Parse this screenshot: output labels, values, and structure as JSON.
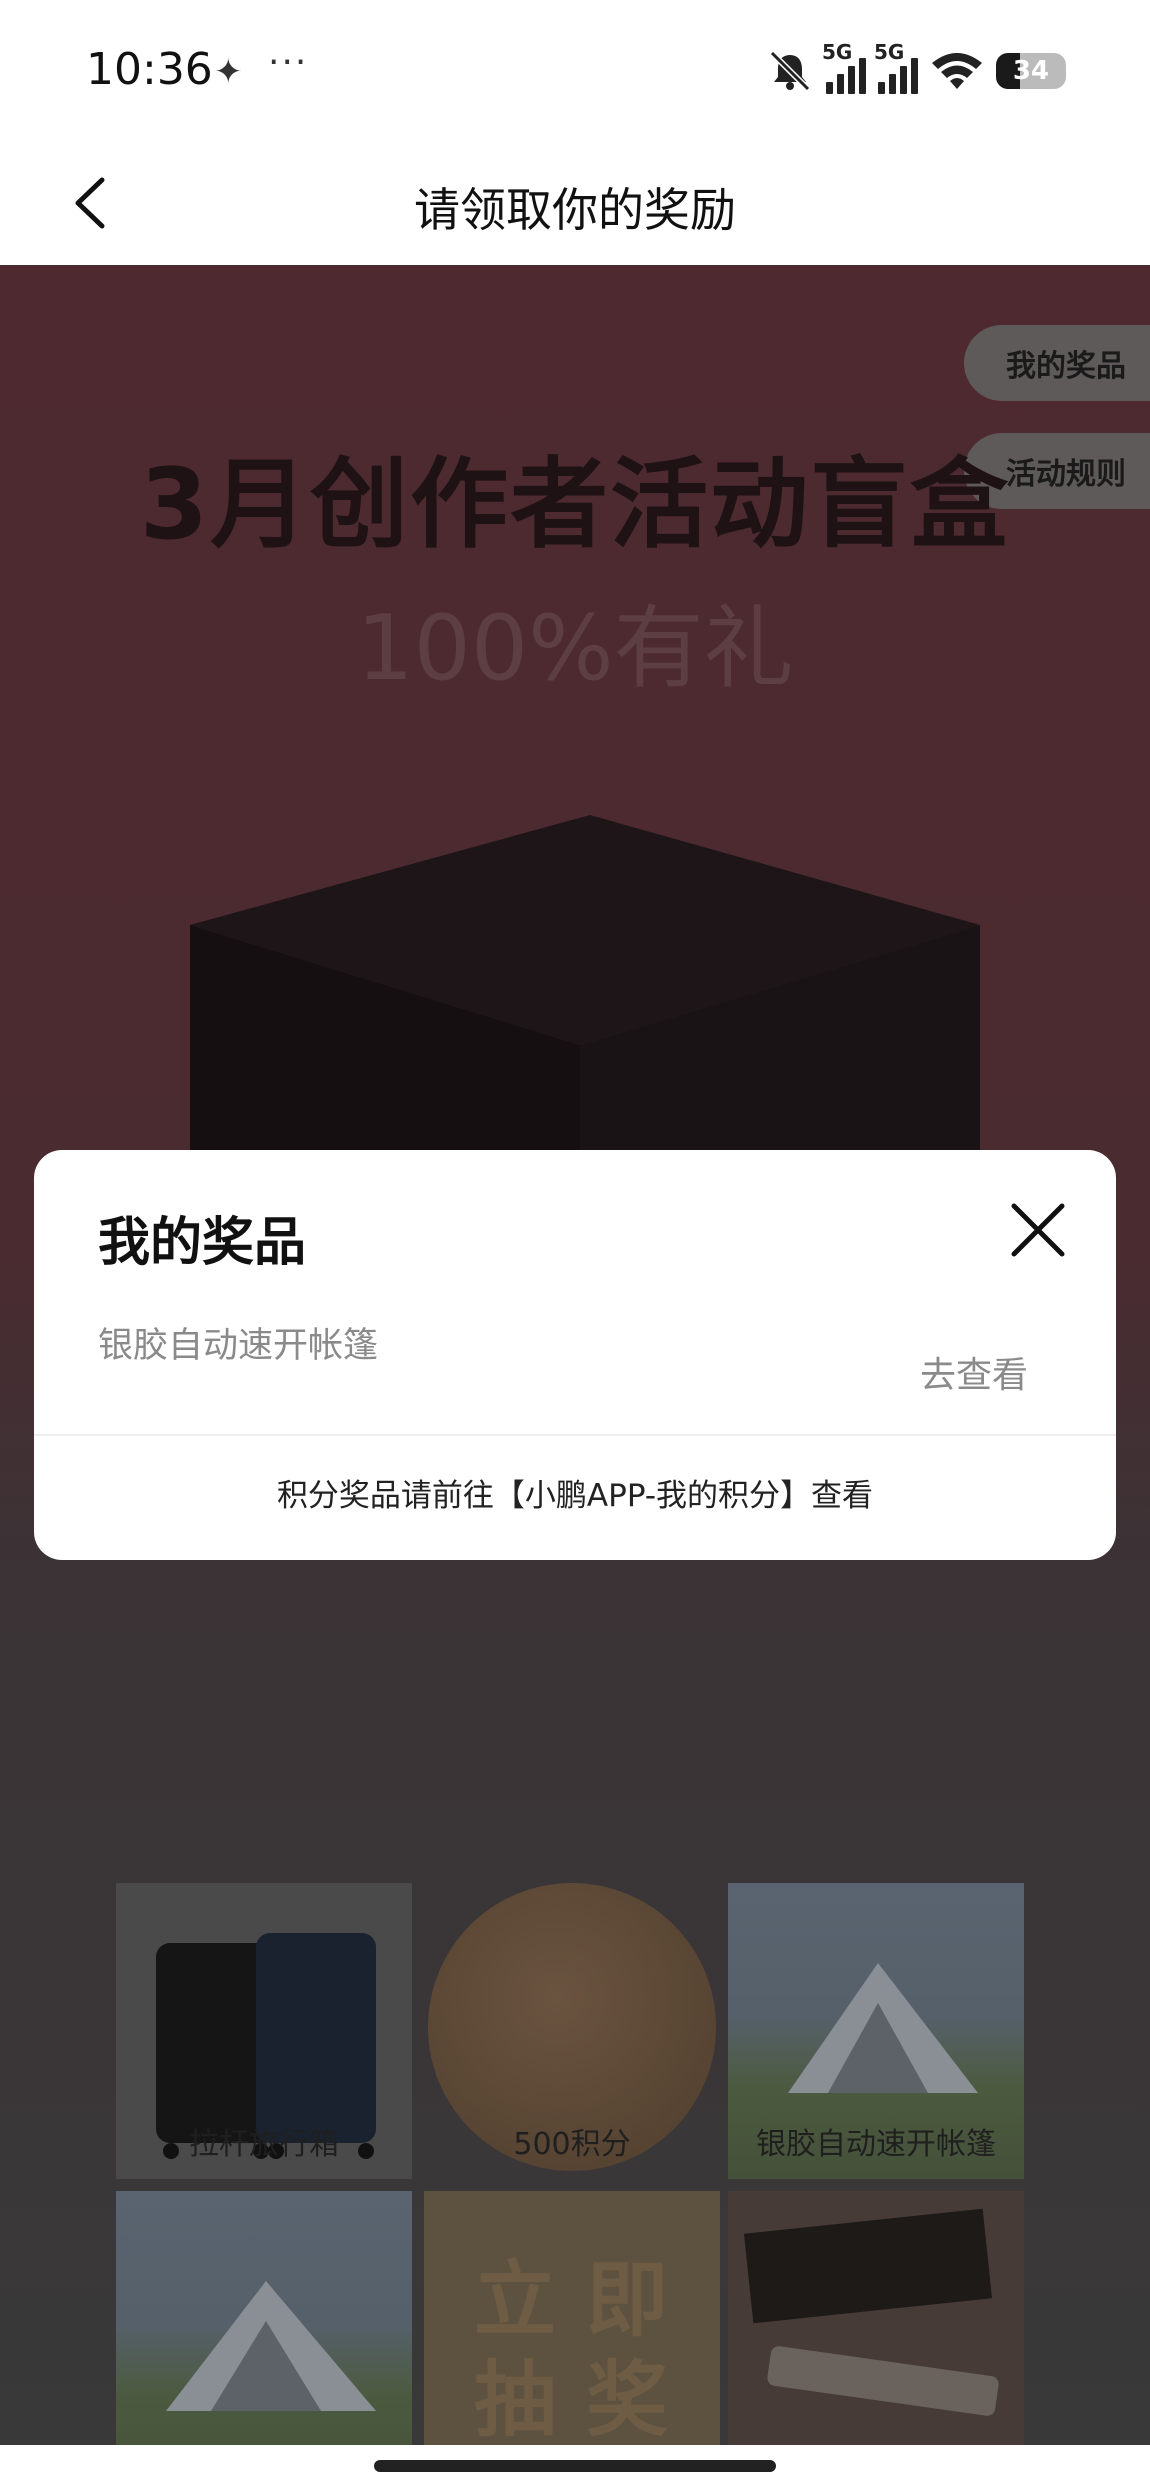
{
  "status_bar": {
    "time": "10:36",
    "dots": "···",
    "signal_label_1": "5G",
    "signal_label_2": "5G",
    "battery": "34"
  },
  "header": {
    "title": "请领取你的奖励"
  },
  "background": {
    "side_buttons": [
      "我的奖品",
      "活动规则"
    ],
    "headline": "3月创作者活动盲盒",
    "subheadline": "100%有礼",
    "prizes": [
      {
        "label": "拉杆旅行箱"
      },
      {
        "label": "500积分"
      },
      {
        "label": "银胶自动速开帐篷"
      }
    ],
    "draw_tile_text": "立即抽奖"
  },
  "modal": {
    "title": "我的奖品",
    "prize_name": "银胶自动速开帐篷",
    "view_label": "去查看",
    "footnote": "积分奖品请前往【小鹏APP-我的积分】查看"
  },
  "colors": {
    "overlay_dim": "#3a3a3a",
    "background_top": "#4e2a30",
    "modal_bg": "#ffffff",
    "muted_text": "#8a8a8a"
  }
}
